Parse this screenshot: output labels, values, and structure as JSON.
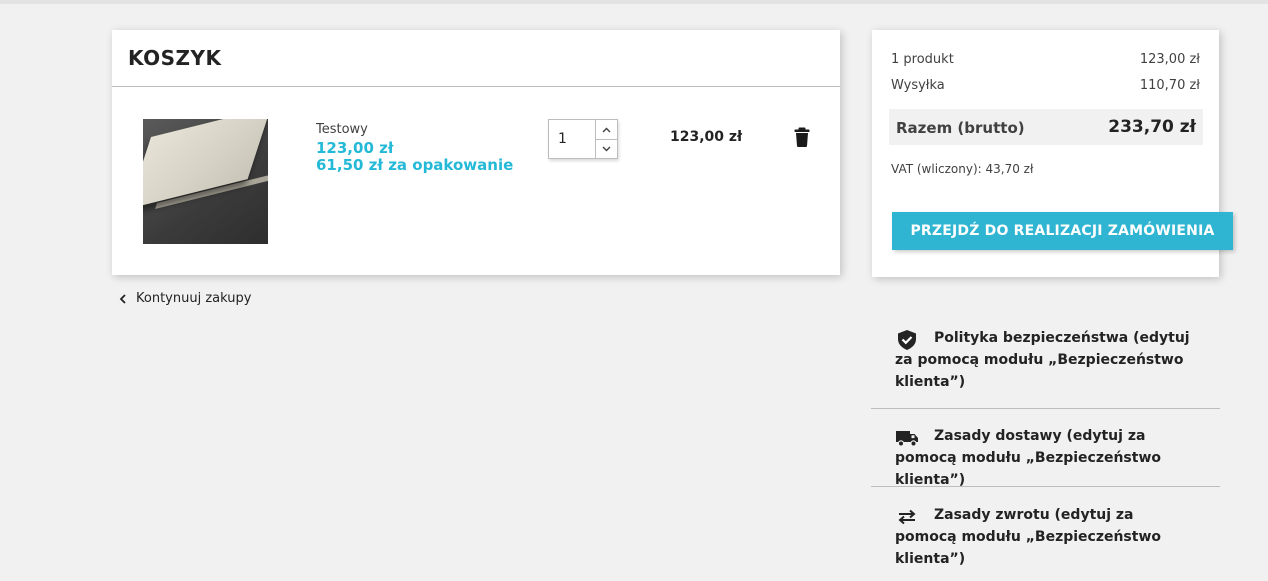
{
  "colors": {
    "accent": "#2fb5d2",
    "price": "#24b9d7",
    "background": "#f1f1f1"
  },
  "cart": {
    "title": "KOSZYK",
    "items": [
      {
        "name": "Testowy",
        "price": "123,00 zł",
        "unit_price": "61,50 zł za opakowanie",
        "quantity": "1",
        "total": "123,00 zł",
        "image_icon": "product-thumbnail"
      }
    ]
  },
  "continue_shopping": "Kontynuuj zakupy",
  "summary": {
    "products_label": "1 produkt",
    "products_value": "123,00 zł",
    "shipping_label": "Wysyłka",
    "shipping_value": "110,70 zł",
    "total_label": "Razem (brutto)",
    "total_value": "233,70 zł",
    "vat": "VAT (wliczony): 43,70 zł",
    "checkout_button": "PRZEJDŹ DO REALIZACJI ZAMÓWIENIA"
  },
  "reassurance": [
    {
      "icon": "shield-check-icon",
      "text": "Polityka bezpieczeństwa (edytuj za pomocą modułu „Bezpieczeństwo klienta”)"
    },
    {
      "icon": "truck-icon",
      "text": "Zasady dostawy (edytuj za pomocą modułu „Bezpieczeństwo klienta”)"
    },
    {
      "icon": "swap-arrows-icon",
      "text": "Zasady zwrotu (edytuj za pomocą modułu „Bezpieczeństwo klienta”)"
    }
  ]
}
